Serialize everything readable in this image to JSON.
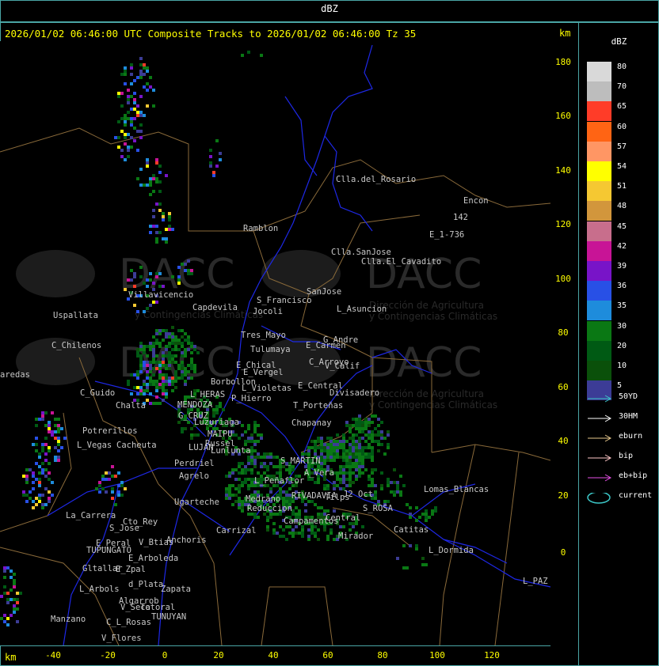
{
  "title": "dBZ",
  "header": "2026/01/02 06:46:00 UTC Composite Tracks to 2026/01/02 06:46:00 Tz 35",
  "km_label": "km",
  "y_axis": [
    "180",
    "160",
    "140",
    "120",
    "100",
    "80",
    "60",
    "40",
    "20",
    "0"
  ],
  "x_axis": [
    "-40",
    "-20",
    "0",
    "20",
    "40",
    "60",
    "80",
    "100",
    "120"
  ],
  "legend": {
    "title": "dBZ",
    "levels": [
      {
        "label": "80",
        "color": "#d9d9d9"
      },
      {
        "label": "70",
        "color": "#bdbdbd"
      },
      {
        "label": "65",
        "color": "#ff3c28"
      },
      {
        "label": "60",
        "color": "#ff6414"
      },
      {
        "label": "57",
        "color": "#ff9664"
      },
      {
        "label": "54",
        "color": "#ffff00"
      },
      {
        "label": "51",
        "color": "#f5c832"
      },
      {
        "label": "48",
        "color": "#d2963c"
      },
      {
        "label": "45",
        "color": "#c86e8c"
      },
      {
        "label": "42",
        "color": "#c81496"
      },
      {
        "label": "39",
        "color": "#7814c8"
      },
      {
        "label": "36",
        "color": "#2850e6"
      },
      {
        "label": "35",
        "color": "#1e8cdc"
      },
      {
        "label": "30",
        "color": "#0a7814"
      },
      {
        "label": "20",
        "color": "#005a14"
      },
      {
        "label": "10",
        "color": "#0a500a"
      },
      {
        "label": "5",
        "color": "#3c3c96"
      }
    ],
    "tracks": [
      {
        "label": "50YD",
        "color": "#3cc8c8"
      },
      {
        "label": "30HM",
        "color": "#ffffff"
      },
      {
        "label": "eburn",
        "color": "#e6c88c"
      },
      {
        "label": "bip",
        "color": "#ffc8c8"
      },
      {
        "label": "eb+bip",
        "color": "#e650e6"
      },
      {
        "label": "current",
        "color": "#3cc8c8"
      }
    ]
  },
  "watermark": {
    "brand": "DACC",
    "line1": "Dirección de Agricultura",
    "line2": "y Contingencias Climáticas"
  },
  "places": [
    "Clla.del_Rosario",
    "Encon",
    "142",
    "E_1-736",
    "Ramblon",
    "Clla.SanJose",
    "Clla.El_Cavadito",
    "Villavicencio",
    "Capdevila",
    "S_Francisco",
    "SanJose",
    "L_Asuncion",
    "Uspallata",
    "Jocoli",
    "Tres_Mayo",
    "Tulumaya",
    "E_Carmen",
    "G_Andre",
    "C_Chilenos",
    "E_Chical",
    "E_Vergel",
    "C_Arroyo",
    "V_Calif",
    "aredas",
    "Borbollon",
    "L_Violetas",
    "E_Central",
    "Divisadero",
    "C_Guido",
    "L_HERAS",
    "P_Hierro",
    "T_Porteñas",
    "Chalta",
    "MENDOZA",
    "G_CRUZ",
    "Luzuriaga",
    "Chapanay",
    "Potrerillos",
    "MAIPU",
    "Russel",
    "L_Vegas",
    "Cacheuta",
    "LUJAN",
    "Lunlunta",
    "Perdriel",
    "S_MARTIN",
    "Agrelo",
    "L_Peñaflor",
    "A_Vera",
    "Ugarteche",
    "Medrano",
    "Reduccion",
    "RIVADAVIA",
    "Tilps",
    "J2 Oct",
    "S_ROSA",
    "Lomas_Blancas",
    "La_Carrera",
    "Cto_Rey",
    "S_Jose",
    "Carrizal",
    "Campamentos",
    "Central",
    "Catitas",
    "E_Peral",
    "V_Btias",
    "Anchoris",
    "TUPUNGATO",
    "Mirador",
    "L_Dormida",
    "E_Arboleda",
    "Gltallar",
    "E_Zpal",
    "L_Arbols",
    "d_Plata",
    "Zapata",
    "Algarrob",
    "V_Seca",
    "Totoral",
    "TUNUYAN",
    "Manzano",
    "C_L_Rosas",
    "V_Flores",
    "L_PAZ"
  ]
}
